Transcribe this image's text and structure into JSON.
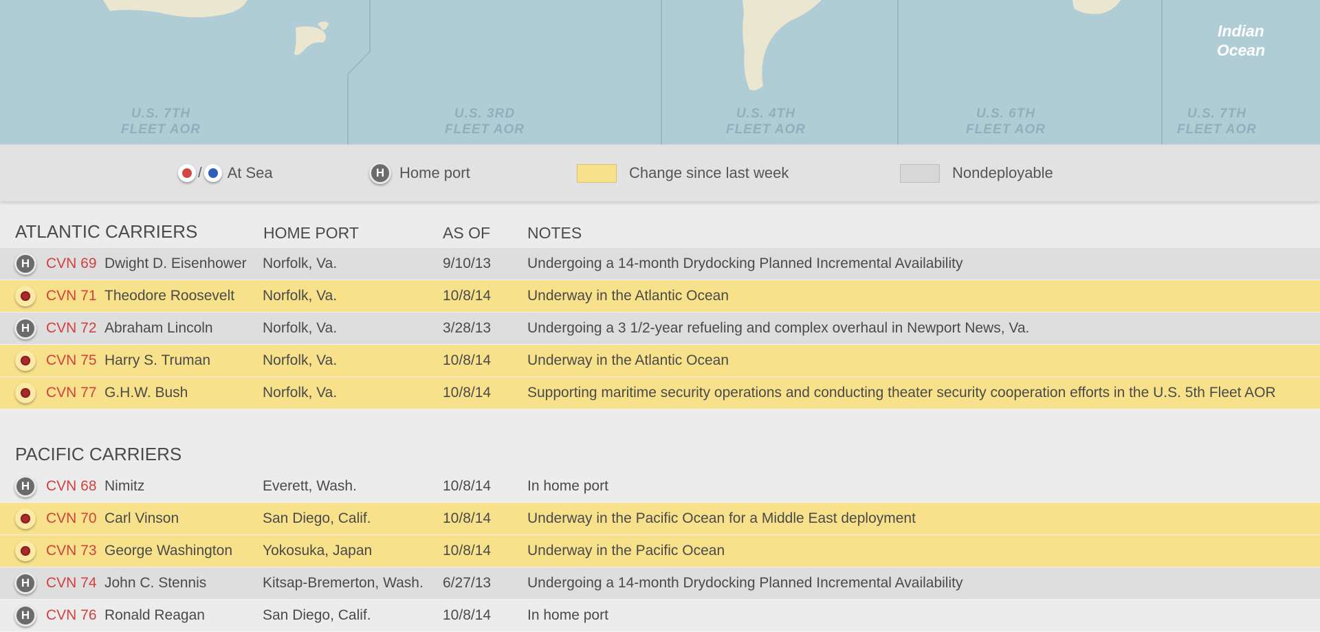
{
  "map": {
    "ocean_label": [
      "Indian",
      "Ocean"
    ],
    "regions": [
      {
        "line1": "U.S. 7TH",
        "line2": "FLEET AOR"
      },
      {
        "line1": "U.S. 3RD",
        "line2": "FLEET AOR"
      },
      {
        "line1": "U.S. 4TH",
        "line2": "FLEET AOR"
      },
      {
        "line1": "U.S. 6TH",
        "line2": "FLEET AOR"
      },
      {
        "line1": "U.S. 7TH",
        "line2": "FLEET AOR"
      }
    ]
  },
  "legend": {
    "at_sea_sep": "/",
    "at_sea": "At Sea",
    "home_port_icon": "H",
    "home_port": "Home port",
    "change": "Change since last week",
    "nondeployable": "Nondeployable"
  },
  "columns": {
    "home_port": "HOME PORT",
    "as_of": "AS OF",
    "notes": "NOTES"
  },
  "atlantic": {
    "title": "ATLANTIC CARRIERS",
    "rows": [
      {
        "status": "home",
        "highlight": "gray",
        "hull": "CVN 69",
        "name": "Dwight D. Eisenhower",
        "port": "Norfolk, Va.",
        "as_of": "9/10/13",
        "notes": "Undergoing a 14-month Drydocking Planned Incremental Availability"
      },
      {
        "status": "sea",
        "highlight": "yellow",
        "hull": "CVN 71",
        "name": "Theodore Roosevelt",
        "port": "Norfolk, Va.",
        "as_of": "10/8/14",
        "notes": "Underway in the Atlantic Ocean"
      },
      {
        "status": "home",
        "highlight": "gray",
        "hull": "CVN 72",
        "name": "Abraham Lincoln",
        "port": "Norfolk, Va.",
        "as_of": "3/28/13",
        "notes": "Undergoing a 3 1/2-year refueling and complex overhaul in Newport News, Va."
      },
      {
        "status": "sea",
        "highlight": "yellow",
        "hull": "CVN 75",
        "name": "Harry S. Truman",
        "port": "Norfolk, Va.",
        "as_of": "10/8/14",
        "notes": "Underway in the Atlantic Ocean"
      },
      {
        "status": "sea",
        "highlight": "yellow",
        "hull": "CVN 77",
        "name": "G.H.W. Bush",
        "port": "Norfolk, Va.",
        "as_of": "10/8/14",
        "notes": "Supporting maritime security operations and conducting theater security cooperation efforts in the U.S. 5th Fleet AOR"
      }
    ]
  },
  "pacific": {
    "title": "PACIFIC CARRIERS",
    "rows": [
      {
        "status": "home",
        "highlight": "white",
        "hull": "CVN 68",
        "name": "Nimitz",
        "port": "Everett, Wash.",
        "as_of": "10/8/14",
        "notes": "In home port"
      },
      {
        "status": "sea",
        "highlight": "yellow",
        "hull": "CVN 70",
        "name": "Carl Vinson",
        "port": "San Diego, Calif.",
        "as_of": "10/8/14",
        "notes": "Underway in the Pacific Ocean for a Middle East deployment"
      },
      {
        "status": "sea",
        "highlight": "yellow",
        "hull": "CVN 73",
        "name": "George Washington",
        "port": "Yokosuka, Japan",
        "as_of": "10/8/14",
        "notes": "Underway in the Pacific Ocean"
      },
      {
        "status": "home",
        "highlight": "gray",
        "hull": "CVN 74",
        "name": "John C. Stennis",
        "port": "Kitsap-Bremerton, Wash.",
        "as_of": "6/27/13",
        "notes": "Undergoing a 14-month Drydocking Planned Incremental Availability"
      },
      {
        "status": "home",
        "highlight": "white",
        "hull": "CVN 76",
        "name": "Ronald Reagan",
        "port": "San Diego, Calif.",
        "as_of": "10/8/14",
        "notes": "In home port"
      }
    ]
  }
}
